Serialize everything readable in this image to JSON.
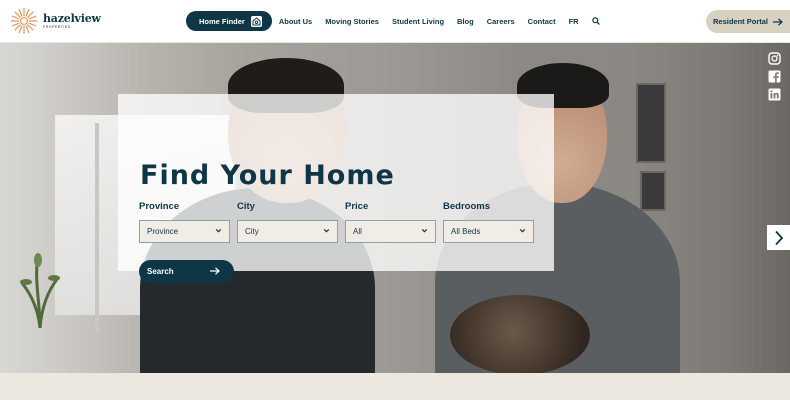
{
  "brand": {
    "name": "hazelview",
    "tagline": "PROPERTIES",
    "colors": {
      "navy": "#0e3647",
      "sand": "#d7d1c2",
      "accent": "#e8925a"
    }
  },
  "nav": {
    "home_finder": "Home Finder",
    "items": [
      "About Us",
      "Moving Stories",
      "Student Living",
      "Blog",
      "Careers",
      "Contact",
      "FR"
    ],
    "search_icon": "search-icon",
    "resident_portal": "Resident Portal"
  },
  "hero": {
    "title": "Find Your Home",
    "fields": [
      {
        "label": "Province",
        "value": "Province"
      },
      {
        "label": "City",
        "value": "City"
      },
      {
        "label": "Price",
        "value": "All"
      },
      {
        "label": "Bedrooms",
        "value": "All Beds"
      }
    ],
    "search_label": "Search"
  },
  "social": [
    "instagram-icon",
    "facebook-icon",
    "linkedin-icon"
  ],
  "carousel": {
    "next_icon": "chevron-right-icon"
  }
}
